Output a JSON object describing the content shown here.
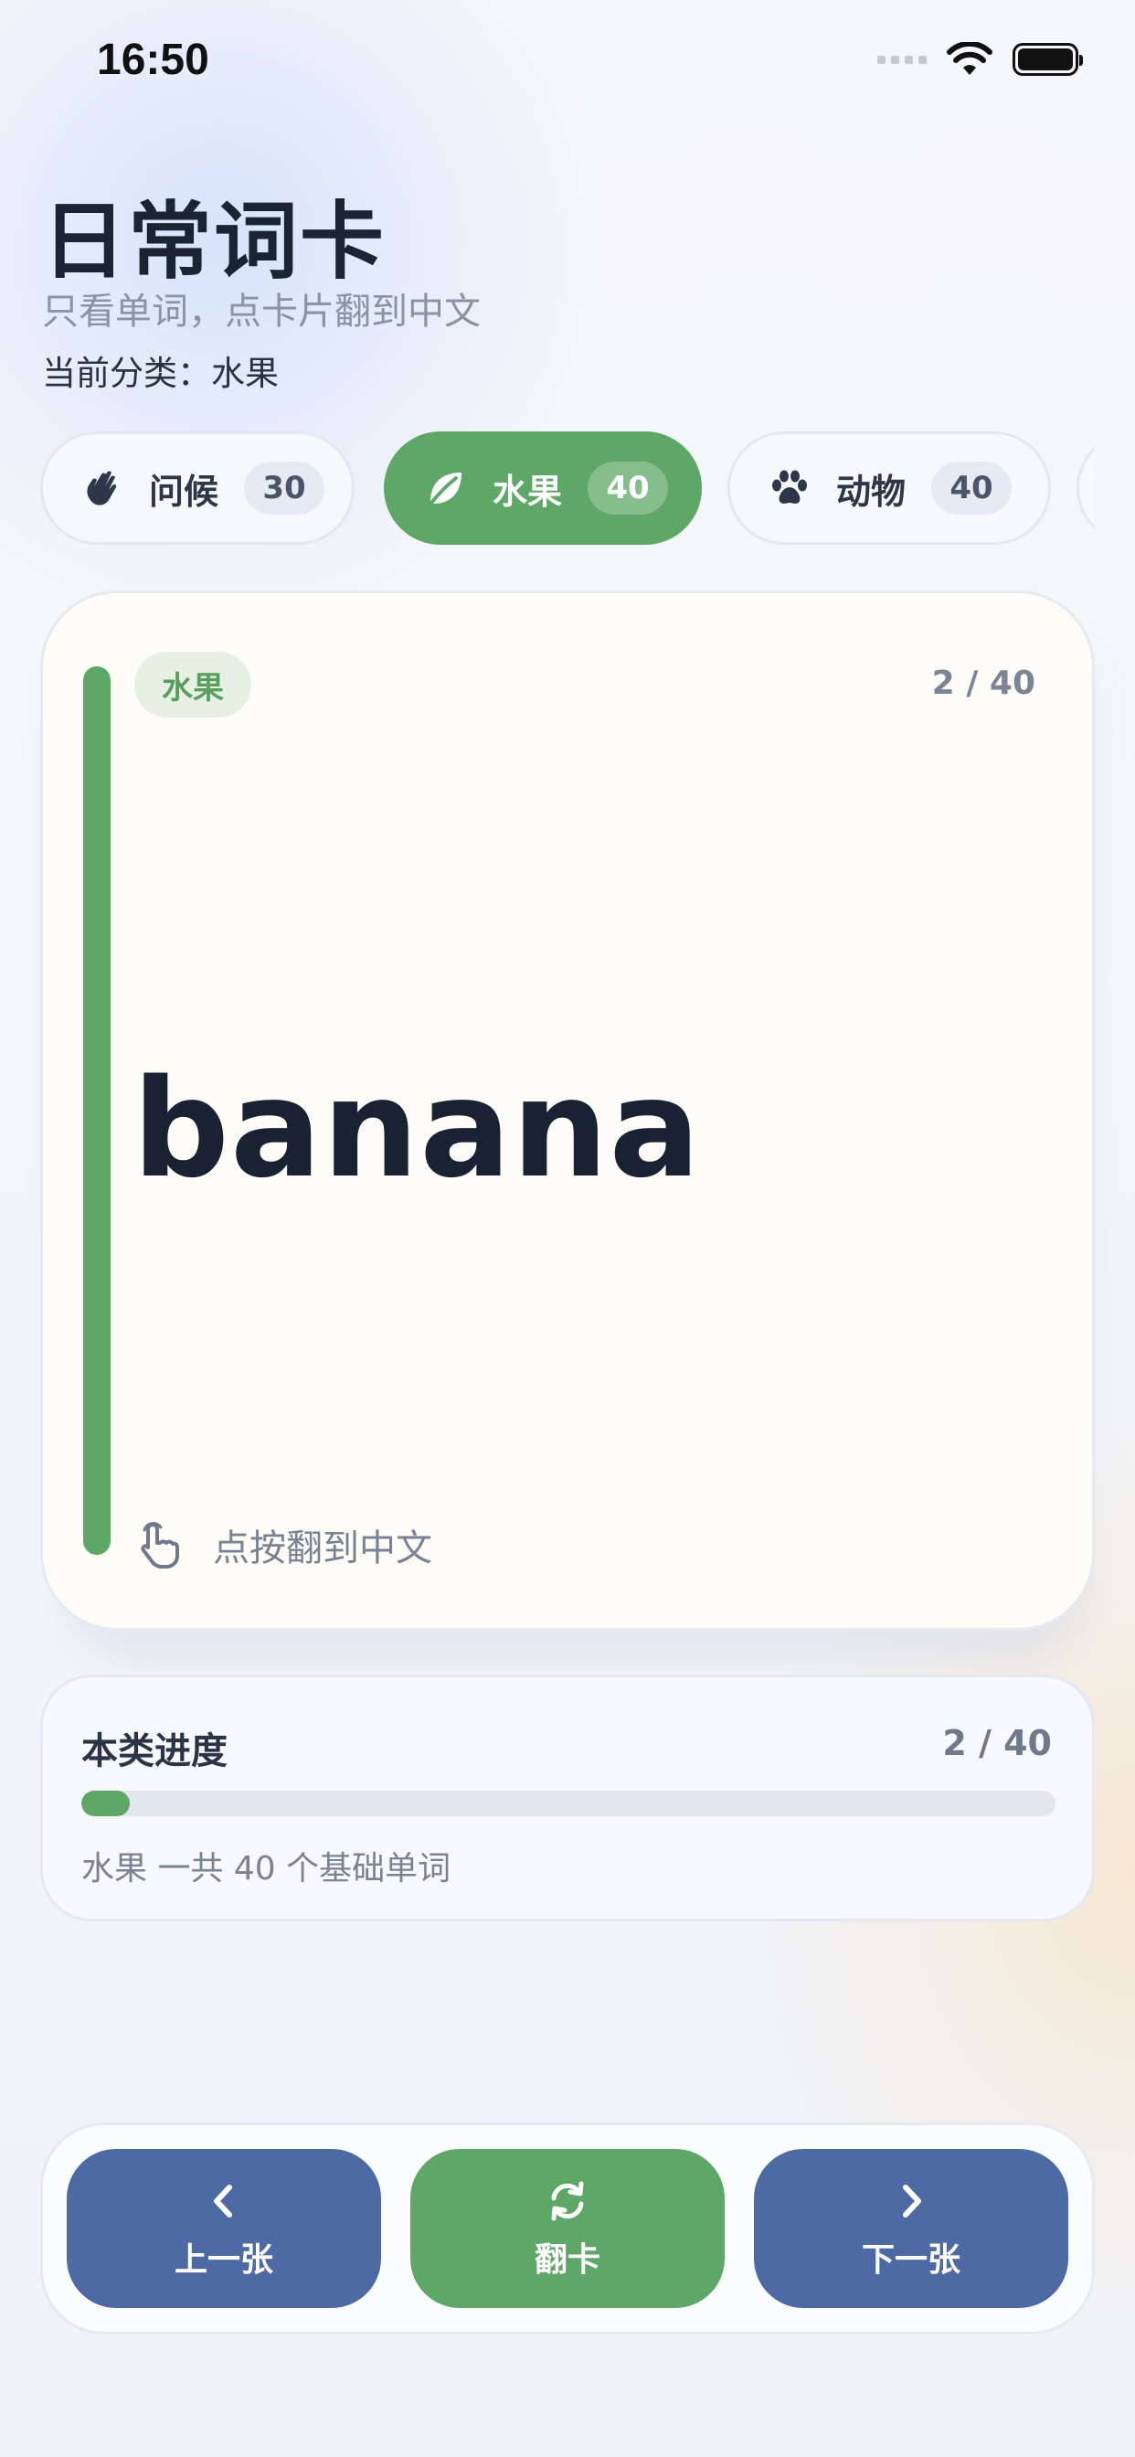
{
  "status_bar": {
    "time": "16:50"
  },
  "header": {
    "title": "日常词卡",
    "subtitle": "只看单词，点卡片翻到中文",
    "current_category": "当前分类：水果"
  },
  "categories": [
    {
      "label": "问候",
      "count": "30",
      "icon": "waving-hand-icon",
      "active": false
    },
    {
      "label": "水果",
      "count": "40",
      "icon": "leaf-icon",
      "active": true
    },
    {
      "label": "动物",
      "count": "40",
      "icon": "paw-icon",
      "active": false
    }
  ],
  "card": {
    "tag": "水果",
    "index": "2 / 40",
    "word": "banana",
    "hint": "点按翻到中文",
    "accent_color": "#5ea766"
  },
  "progress": {
    "title": "本类进度",
    "count": "2 / 40",
    "fraction": 0.05,
    "note": "水果 一共 40 个基础单词"
  },
  "actions": {
    "prev_label": "上一张",
    "flip_label": "翻卡",
    "next_label": "下一张"
  },
  "colors": {
    "primary_green": "#5ea766",
    "primary_blue": "#4e6aa5",
    "text_dark": "#1b2433"
  }
}
